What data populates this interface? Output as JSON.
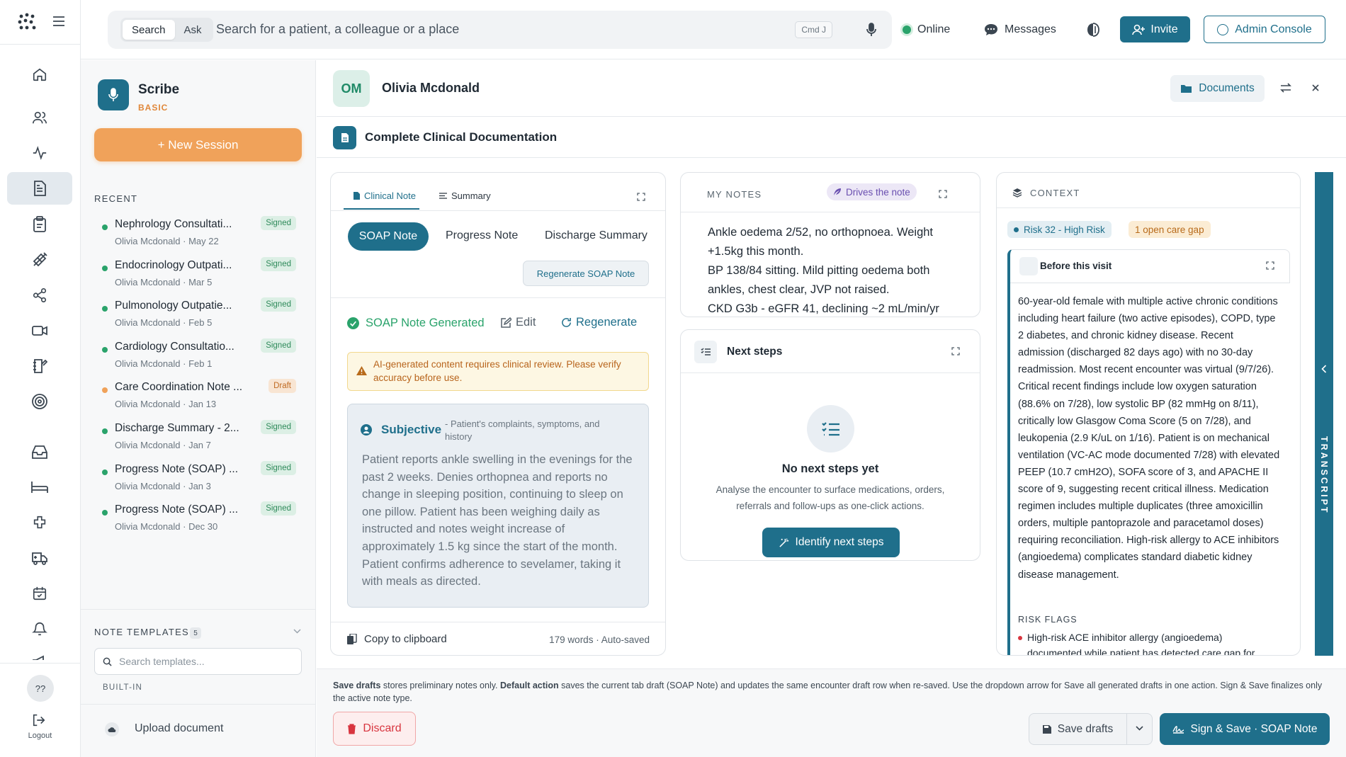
{
  "topbar": {
    "search_mode": [
      "Search",
      "Ask"
    ],
    "search_placeholder": "Search for a patient, a colleague or a place",
    "shortcut": "Cmd J",
    "status": "Online",
    "messages": "Messages",
    "invite": "Invite",
    "admin": "Admin Console"
  },
  "rail": {
    "help": "??",
    "logout": "Logout"
  },
  "scribe": {
    "title": "Scribe",
    "plan": "BASIC",
    "new_session": "+ New Session",
    "recent_label": "RECENT",
    "recent": [
      {
        "title": "Nephrology Consultati...",
        "patient": "Olivia Mcdonald",
        "date": "May 22",
        "status": "Signed"
      },
      {
        "title": "Endocrinology Outpati...",
        "patient": "Olivia Mcdonald",
        "date": "Mar 5",
        "status": "Signed"
      },
      {
        "title": "Pulmonology Outpatie...",
        "patient": "Olivia Mcdonald",
        "date": "Feb 5",
        "status": "Signed"
      },
      {
        "title": "Cardiology Consultatio...",
        "patient": "Olivia Mcdonald",
        "date": "Feb 1",
        "status": "Signed"
      },
      {
        "title": "Care Coordination Note ...",
        "patient": "Olivia Mcdonald",
        "date": "Jan 13",
        "status": "Draft"
      },
      {
        "title": "Discharge Summary - 2...",
        "patient": "Olivia Mcdonald",
        "date": "Jan 7",
        "status": "Signed"
      },
      {
        "title": "Progress Note (SOAP) ...",
        "patient": "Olivia Mcdonald",
        "date": "Jan 3",
        "status": "Signed"
      },
      {
        "title": "Progress Note (SOAP) ...",
        "patient": "Olivia Mcdonald",
        "date": "Dec 30",
        "status": "Signed"
      }
    ],
    "templates_label": "NOTE TEMPLATES",
    "templates_count": "5",
    "template_search_placeholder": "Search templates...",
    "builtin_label": "BUILT-IN",
    "upload": "Upload document"
  },
  "patient": {
    "initials": "OM",
    "name": "Olivia Mcdonald",
    "documents": "Documents"
  },
  "doc_title": "Complete Clinical Documentation",
  "note_panel": {
    "tabs": [
      "Clinical Note",
      "Summary"
    ],
    "note_types": [
      "SOAP Note",
      "Progress Note",
      "Discharge Summary"
    ],
    "regenerate_btn": "Regenerate SOAP Note",
    "generated": "SOAP Note Generated",
    "edit": "Edit",
    "regenerate": "Regenerate",
    "warning": "AI-generated content requires clinical review. Please verify accuracy before use.",
    "section_title": "Subjective",
    "section_hint": "- Patient's complaints, symptoms, and history",
    "section_body": "Patient reports ankle swelling in the evenings for the past 2 weeks. Denies orthopnea and reports no change in sleeping position, continuing to sleep on one pillow. Patient has been weighing daily as instructed and notes weight increase of approximately 1.5 kg since the start of the month. Patient confirms adherence to sevelamer, taking it with meals as directed.",
    "copy": "Copy to clipboard",
    "word_count": "179 words · Auto-saved"
  },
  "my_notes": {
    "label": "MY NOTES",
    "drives": "Drives the note",
    "lines": [
      "Ankle oedema 2/52, no orthopnoea. Weight",
      "+1.5kg this month.",
      "BP 138/84 sitting. Mild pitting oedema both",
      "ankles, chest clear, JVP not raised.",
      "CKD G3b - eGFR 41, declining ~2 mL/min/yr"
    ]
  },
  "next_steps": {
    "title": "Next steps",
    "empty_title": "No next steps yet",
    "empty_desc": "Analyse the encounter to surface medications, orders, referrals and follow-ups as one-click actions.",
    "button": "Identify next steps"
  },
  "context": {
    "label": "CONTEXT",
    "risk": "Risk 32 - High Risk",
    "gap": "1 open care gap",
    "before_title": "Before this visit",
    "summary": "60-year-old female with multiple active chronic conditions including heart failure (two active episodes), COPD, type 2 diabetes, and chronic kidney disease. Recent admission (discharged 82 days ago) with no 30-day readmission. Most recent encounter was virtual (9/7/26). Critical recent findings include low oxygen saturation (88.6% on 7/28), low systolic BP (82 mmHg on 8/11), critically low Glasgow Coma Score (5 on 7/28), and leukopenia (2.9 K/uL on 1/16). Patient is on mechanical ventilation (VC-AC mode documented 7/28) with elevated PEEP (10.7 cmH2O), SOFA score of 3, and APACHE II score of 9, suggesting recent critical illness. Medication regimen includes multiple duplicates (three amoxicillin orders, multiple pantoprazole and paracetamol doses) requiring reconciliation. High-risk allergy to ACE inhibitors (angioedema) complicates standard diabetic kidney disease management.",
    "risk_flags_label": "RISK FLAGS",
    "risk_flag_1": "High-risk ACE inhibitor allergy (angioedema) documented while patient has detected care gap for"
  },
  "transcript_tab": "TRANSCRIPT",
  "footer": {
    "info_parts": [
      "Save drafts",
      " stores preliminary notes only. ",
      "Default action",
      " saves the current tab draft (SOAP Note) and updates the same encounter draft row when re-saved. Use the dropdown arrow for Save all generated drafts in one action. Sign & Save finalizes only the active note type."
    ],
    "discard": "Discard",
    "save_drafts": "Save drafts",
    "sign_save": "Sign & Save · SOAP Note"
  },
  "colors": {
    "teal": "#1f6f8b",
    "orange": "#f0a25a",
    "green": "#2aa36b",
    "red": "#d8353f"
  }
}
